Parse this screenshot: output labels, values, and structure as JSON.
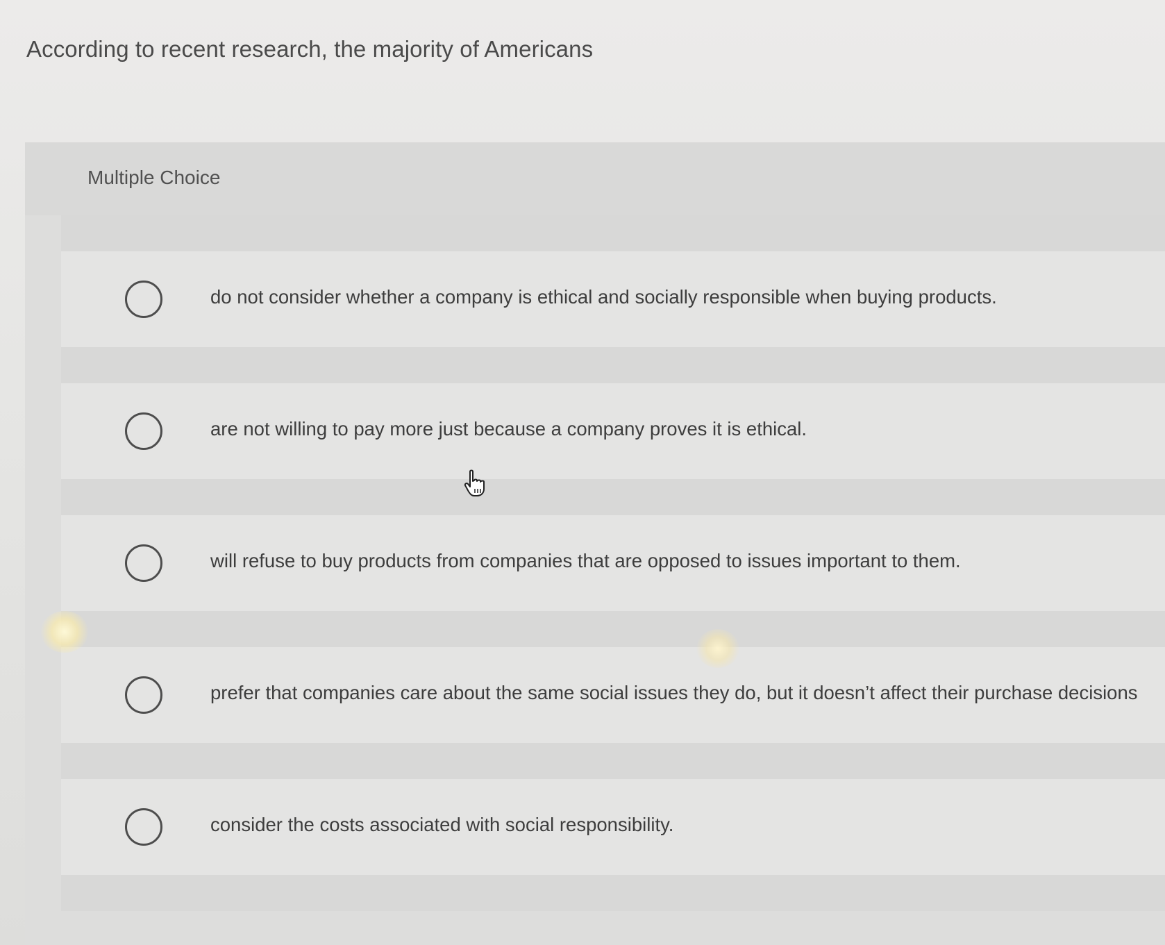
{
  "question": {
    "text": "According to recent research, the majority of Americans"
  },
  "panel": {
    "type_label": "Multiple Choice"
  },
  "options": [
    {
      "label": "do not consider whether a company is ethical and socially responsible when buying products.",
      "selected": false
    },
    {
      "label": "are not willing to pay more just because a company proves it is ethical.",
      "selected": false
    },
    {
      "label": "will refuse to buy products from companies that are opposed to issues important to them.",
      "selected": false
    },
    {
      "label": "prefer that companies care about the same social issues they do, but it doesn’t affect their purchase decisions",
      "selected": false
    },
    {
      "label": "consider the costs associated with social responsibility.",
      "selected": false
    }
  ],
  "icons": {
    "radio": "radio-unselected-icon",
    "cursor": "hand-pointer-icon"
  }
}
